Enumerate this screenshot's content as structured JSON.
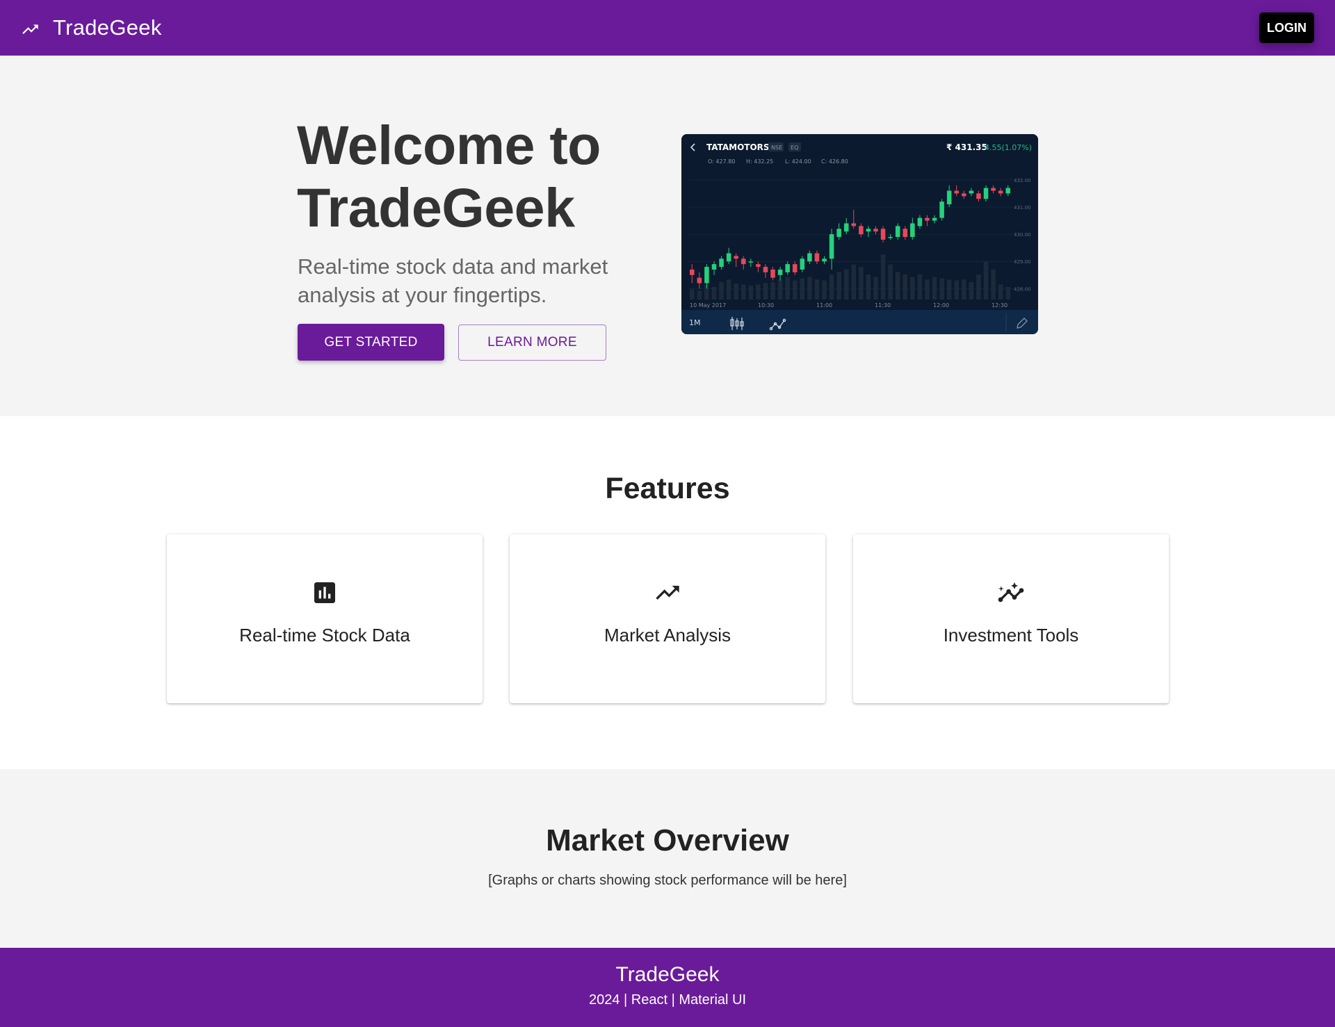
{
  "header": {
    "brand": "TradeGeek",
    "login_label": "LOGIN"
  },
  "hero": {
    "title": "Welcome to TradeGeek",
    "subtitle": "Real-time stock data and market analysis at your fingertips.",
    "primary_button": "GET STARTED",
    "secondary_button": "LEARN MORE"
  },
  "stock_widget": {
    "symbol": "TATAMOTORS",
    "exchange": "NSE",
    "segment": "EQ",
    "price": "₹ 431.35",
    "change": "4.55(1.07%)",
    "open": "O: 427.80",
    "high": "H: 432.25",
    "low": "L: 424.00",
    "close": "C: 426.80",
    "interval": "1M",
    "x_labels": [
      "10 May 2017",
      "10:30",
      "11:00",
      "11:30",
      "12:00",
      "12:30"
    ],
    "y_labels": [
      "432.00",
      "431.00",
      "430.00",
      "429.00",
      "428.00"
    ],
    "colors": {
      "up": "#26d07c",
      "down": "#e8475a",
      "background": "#0b1a2e"
    },
    "candles": [
      [
        428.7,
        428.5,
        428.9,
        428.2
      ],
      [
        428.4,
        428.2,
        428.6,
        428.0
      ],
      [
        428.2,
        428.8,
        428.9,
        428.0
      ],
      [
        428.7,
        428.9,
        429.0,
        428.5
      ],
      [
        428.8,
        429.1,
        429.2,
        428.7
      ],
      [
        429.0,
        429.3,
        429.5,
        428.9
      ],
      [
        429.2,
        429.1,
        429.3,
        428.8
      ],
      [
        429.1,
        428.9,
        429.2,
        428.7
      ],
      [
        429.0,
        429.0,
        429.1,
        428.8
      ],
      [
        428.9,
        428.8,
        429.0,
        428.6
      ],
      [
        428.8,
        428.6,
        428.9,
        428.4
      ],
      [
        428.7,
        428.4,
        428.8,
        428.3
      ],
      [
        428.5,
        428.7,
        428.8,
        428.3
      ],
      [
        428.6,
        428.9,
        429.0,
        428.5
      ],
      [
        428.9,
        428.6,
        429.0,
        428.5
      ],
      [
        428.7,
        429.1,
        429.2,
        428.6
      ],
      [
        429.0,
        429.3,
        429.4,
        428.9
      ],
      [
        429.3,
        429.0,
        429.4,
        428.9
      ],
      [
        429.0,
        429.1,
        429.2,
        428.9
      ],
      [
        429.1,
        430.0,
        430.2,
        428.7
      ],
      [
        429.9,
        430.2,
        430.4,
        429.8
      ],
      [
        430.1,
        430.4,
        430.6,
        430.0
      ],
      [
        430.4,
        430.3,
        430.9,
        430.2
      ],
      [
        430.3,
        430.0,
        430.4,
        429.9
      ],
      [
        430.1,
        430.2,
        430.3,
        429.9
      ],
      [
        430.2,
        430.1,
        430.3,
        430.0
      ],
      [
        430.2,
        429.8,
        430.3,
        429.7
      ],
      [
        429.9,
        429.9,
        430.0,
        429.8
      ],
      [
        429.9,
        430.3,
        430.4,
        429.8
      ],
      [
        430.2,
        429.9,
        430.3,
        429.8
      ],
      [
        429.9,
        430.4,
        430.6,
        429.8
      ],
      [
        430.3,
        430.6,
        430.7,
        430.2
      ],
      [
        430.6,
        430.5,
        430.7,
        430.3
      ],
      [
        430.5,
        430.6,
        430.7,
        430.4
      ],
      [
        430.6,
        431.2,
        431.3,
        430.5
      ],
      [
        431.1,
        431.6,
        431.8,
        431.0
      ],
      [
        431.6,
        431.5,
        431.8,
        431.4
      ],
      [
        431.5,
        431.4,
        431.6,
        431.3
      ],
      [
        431.5,
        431.6,
        431.7,
        431.4
      ],
      [
        431.5,
        431.3,
        431.6,
        431.2
      ],
      [
        431.3,
        431.7,
        431.8,
        431.2
      ],
      [
        431.7,
        431.6,
        431.8,
        431.5
      ],
      [
        431.6,
        431.5,
        431.7,
        431.4
      ],
      [
        431.5,
        431.7,
        431.8,
        431.4
      ]
    ],
    "volumes": [
      0.2,
      0.18,
      0.3,
      0.25,
      0.35,
      0.4,
      0.32,
      0.3,
      0.28,
      0.3,
      0.33,
      0.35,
      0.4,
      0.45,
      0.38,
      0.42,
      0.45,
      0.4,
      0.38,
      0.5,
      0.55,
      0.6,
      0.7,
      0.65,
      0.5,
      0.45,
      0.9,
      0.7,
      0.55,
      0.5,
      0.45,
      0.5,
      0.4,
      0.45,
      0.42,
      0.4,
      0.38,
      0.4,
      0.35,
      0.5,
      0.75,
      0.6,
      0.3,
      0.25
    ]
  },
  "features": {
    "title": "Features",
    "cards": [
      {
        "title": "Real-time Stock Data",
        "icon": "bar-chart-icon"
      },
      {
        "title": "Market Analysis",
        "icon": "trending-up-icon"
      },
      {
        "title": "Investment Tools",
        "icon": "insights-icon"
      }
    ]
  },
  "market": {
    "title": "Market Overview",
    "note": "[Graphs or charts showing stock performance will be here]"
  },
  "footer": {
    "title": "TradeGeek",
    "meta": "2024 | React | Material UI"
  }
}
